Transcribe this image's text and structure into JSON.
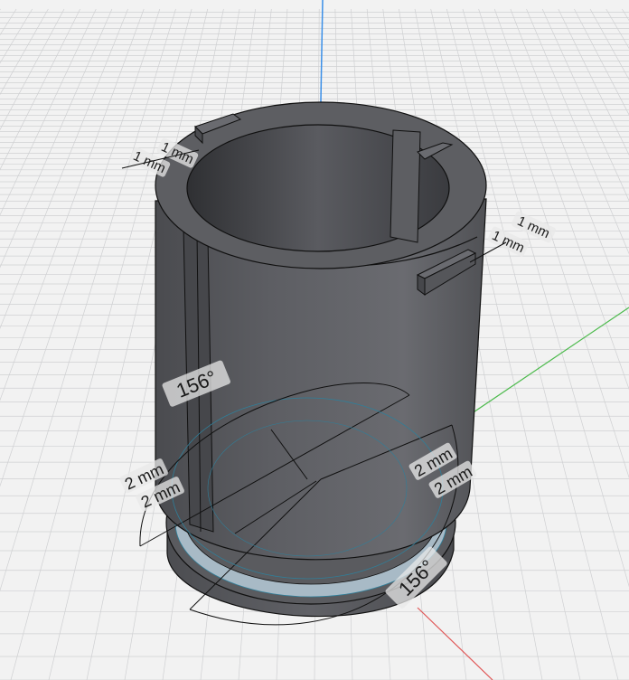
{
  "viewport": {
    "background": "#f2f2f2",
    "grid_color": "#cfd0d2",
    "axis_colors": {
      "y": "#3a8fe8",
      "x": "#e05555",
      "z": "#4cba4c"
    }
  },
  "model": {
    "body_color": "#55565a",
    "edge_color": "#101010",
    "sketch_ring_color": "#a8bac6",
    "sketch_line_color": "#2f7f9a"
  },
  "dimensions": {
    "top_left_outer": "1 mm",
    "top_left_inner": "1 mm",
    "top_right_outer": "1 mm",
    "top_right_inner": "1 mm",
    "left_outer": "2 mm",
    "left_inner": "2 mm",
    "right_outer": "2 mm",
    "right_inner": "2 mm",
    "angle_top": "156°",
    "angle_bottom": "156°"
  }
}
